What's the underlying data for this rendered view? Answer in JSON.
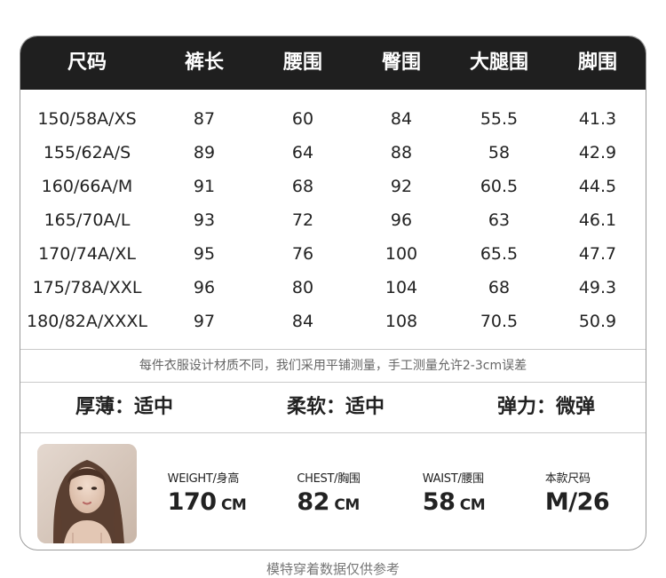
{
  "table": {
    "headers": [
      "尺码",
      "裤长",
      "腰围",
      "臀围",
      "大腿围",
      "脚围"
    ],
    "rows": [
      [
        "150/58A/XS",
        "87",
        "60",
        "84",
        "55.5",
        "41.3"
      ],
      [
        "155/62A/S",
        "89",
        "64",
        "88",
        "58",
        "42.9"
      ],
      [
        "160/66A/M",
        "91",
        "68",
        "92",
        "60.5",
        "44.5"
      ],
      [
        "165/70A/L",
        "93",
        "72",
        "96",
        "63",
        "46.1"
      ],
      [
        "170/74A/XL",
        "95",
        "76",
        "100",
        "65.5",
        "47.7"
      ],
      [
        "175/78A/XXL",
        "96",
        "80",
        "104",
        "68",
        "49.3"
      ],
      [
        "180/82A/XXXL",
        "97",
        "84",
        "108",
        "70.5",
        "50.9"
      ]
    ]
  },
  "note": "每件衣服设计材质不同，我们采用平铺测量，手工测量允许2-3cm误差",
  "properties": [
    {
      "label": "厚薄",
      "value": "适中"
    },
    {
      "label": "柔软",
      "value": "适中"
    },
    {
      "label": "弹力",
      "value": "微弹"
    }
  ],
  "property_separator": "：",
  "model": {
    "stats": [
      {
        "label": "WEIGHT/身高",
        "value": "170",
        "unit": " CM"
      },
      {
        "label": "CHEST/胸围",
        "value": "82",
        "unit": " CM"
      },
      {
        "label": "WAIST/腰围",
        "value": "58",
        "unit": " CM"
      },
      {
        "label": "本款尺码",
        "value": "M/26",
        "unit": ""
      }
    ]
  },
  "footer": "模特穿着数据仅供参考",
  "colors": {
    "header_bg": "#1f1f1f",
    "header_text": "#ffffff",
    "border": "#9a9a9a"
  }
}
